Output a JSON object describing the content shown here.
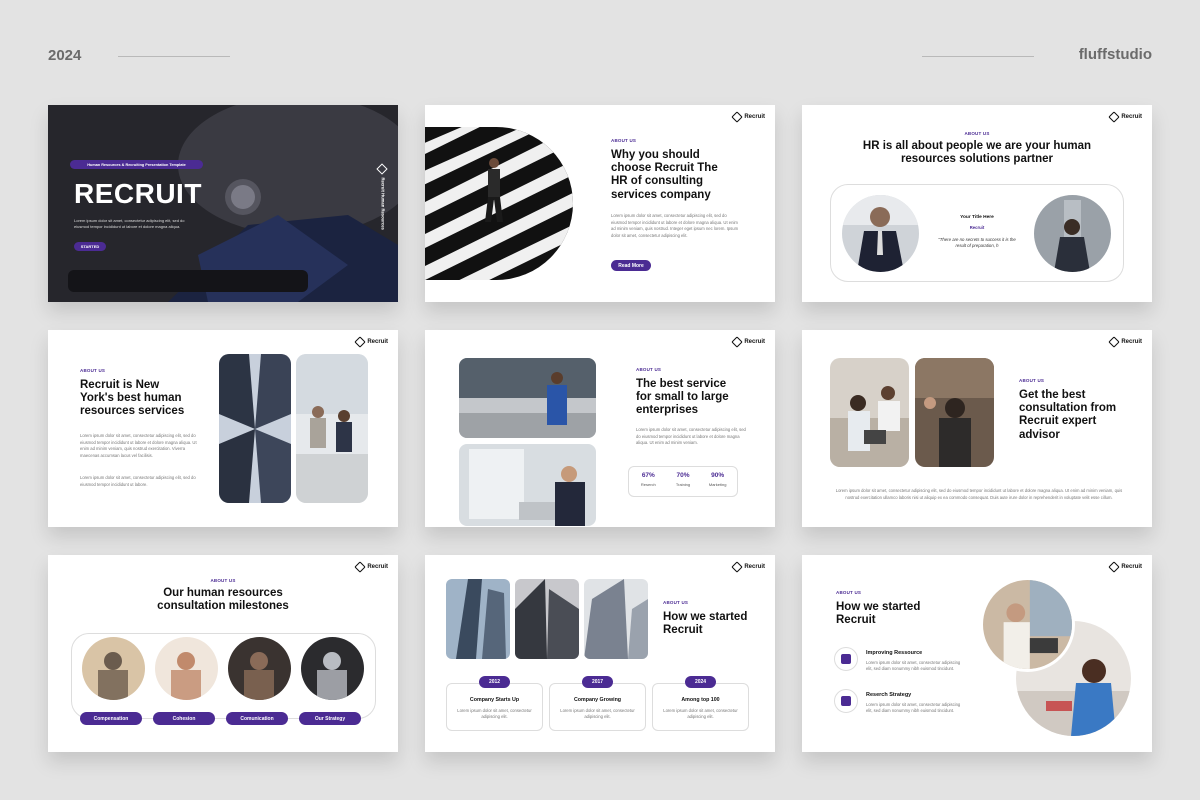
{
  "header": {
    "year": "2024",
    "brand": "fluffstudio"
  },
  "brand_logo": "Recruit",
  "s1": {
    "badge": "Human Resources & Recruiting Presentation Template",
    "title": "RECRUIT",
    "body": "Lorem ipsum dolor sit amet, consectetur adipiscing elit, sed do eiusmod tempor incididunt ut labore et dolore magna aliqua.",
    "button": "STARTED",
    "side": "Recruit Human Resources"
  },
  "s2": {
    "kicker": "ABOUT US",
    "title": "Why you should choose Recruit The HR of consulting services company",
    "body": "Lorem ipsum dolor sit amet, consectetur adipiscing elit, sed do eiusmod tempor incididunt ut labore et dolore magna aliqua. Ut enim ad minim veniam, quis nostrud. Integer eget ipsum nec lorem. Ipsum dolor sit amet, consectetur adipiscing elit.",
    "button": "Read More"
  },
  "s3": {
    "kicker": "ABOUT US",
    "title": "HR is all about people we are your human resources solutions partner",
    "name": "Your Title Here",
    "role": "Recruit",
    "quote": "\"There are no secrets to success it is the result of preparation, h"
  },
  "s4": {
    "kicker": "ABOUT US",
    "title": "Recruit is New York's best human resources services",
    "body1": "Lorem ipsum dolor sit amet, consectetur adipiscing elit, sed do eiusmod tempor incididunt ut labore et dolore magna aliqua. Ut enim ad minim veniam, quis nostrud exercitation. Viverra maecenas accumsan lacus vel facilisis.",
    "body2": "Lorem ipsum dolor sit amet, consectetur adipiscing elit, sed do eiusmod tempor incididunt ut labore."
  },
  "s5": {
    "kicker": "ABOUT US",
    "title": "The best service for small to large enterprises",
    "body": "Lorem ipsum dolor sit amet, consectetur adipiscing elit, sed do eiusmod tempor incididunt ut labore et dolore magna aliqua. Ut enim ad minim veniam.",
    "stats": [
      {
        "value": "67%",
        "label": "Reserch"
      },
      {
        "value": "70%",
        "label": "Training"
      },
      {
        "value": "90%",
        "label": "Marketing"
      }
    ]
  },
  "s6": {
    "kicker": "ABOUT US",
    "title": "Get the best consultation from Recruit expert advisor",
    "body": "Lorem ipsum dolor sit amet, consectetur adipiscing elit, sed do eiusmod tempor incididunt ut labore et dolore magna aliqua. Ut enim ad minim veniam, quis nostrud exercitation ullamco laboris nisi ut aliquip ex ea commodo consequat. Duis aute irure dolor in reprehenderit in voluptate velit esse cillum."
  },
  "s7": {
    "kicker": "ABOUT US",
    "title": "Our human resources consultation milestones",
    "labels": [
      "Compensation",
      "Cohesion",
      "Comunication",
      "Our Strategy"
    ]
  },
  "s8": {
    "kicker": "ABOUT US",
    "title": "How we started Recruit",
    "items": [
      {
        "year": "2012",
        "title": "Company Starts Up",
        "body": "Lorem ipsum dolor sit amet, consectetur adipiscing elit."
      },
      {
        "year": "2017",
        "title": "Company Growing",
        "body": "Lorem ipsum dolor sit amet, consectetur adipiscing elit."
      },
      {
        "year": "2024",
        "title": "Among top 100",
        "body": "Lorem ipsum dolor sit amet, consectetur adipiscing elit."
      }
    ]
  },
  "s9": {
    "kicker": "ABOUT US",
    "title": "How we started Recruit",
    "items": [
      {
        "title": "Improving Ressource",
        "body": "Lorem ipsum dolor sit amet, consectetur adipiscing elit, sed diam nonummy nibh euismod tincidunt."
      },
      {
        "title": "Reserch Strategy",
        "body": "Lorem ipsum dolor sit amet, consectetur adipiscing elit, sed diam nonummy nibh euismod tincidunt."
      }
    ]
  },
  "colors": {
    "accent": "#4b2b93",
    "background": "#e3e3e3",
    "slide": "#ffffff",
    "text": "#111111"
  }
}
